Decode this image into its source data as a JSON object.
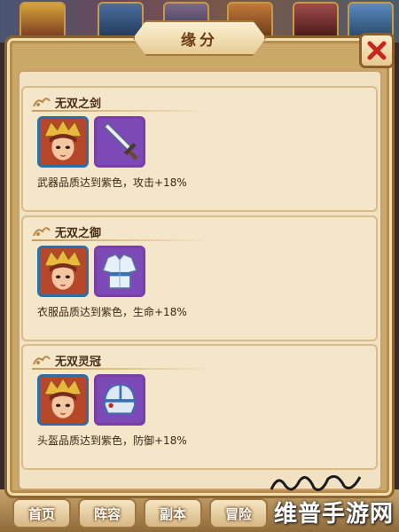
{
  "dialog": {
    "title": "缘分",
    "close_icon": "close-x-icon"
  },
  "entries": [
    {
      "title": "无双之剑",
      "hero_icon": "hero-portrait",
      "item_icon": "sword-icon",
      "description": "武器品质达到紫色，攻击+18%"
    },
    {
      "title": "无双之御",
      "hero_icon": "hero-portrait",
      "item_icon": "armor-robe-icon",
      "description": "衣服品质达到紫色，生命+18%"
    },
    {
      "title": "无双灵冠",
      "hero_icon": "hero-portrait",
      "item_icon": "helmet-icon",
      "description": "头盔品质达到紫色，防御+18%"
    }
  ],
  "bottom_nav": {
    "tabs": [
      "首页",
      "阵容",
      "副本",
      "冒险"
    ]
  },
  "watermark": {
    "text": "维普手游网"
  },
  "colors": {
    "hero_frame": "#2c6fa8",
    "purple_frame": "#7a3ea6",
    "close_red": "#c8261d",
    "title_brown": "#6b3d14"
  }
}
